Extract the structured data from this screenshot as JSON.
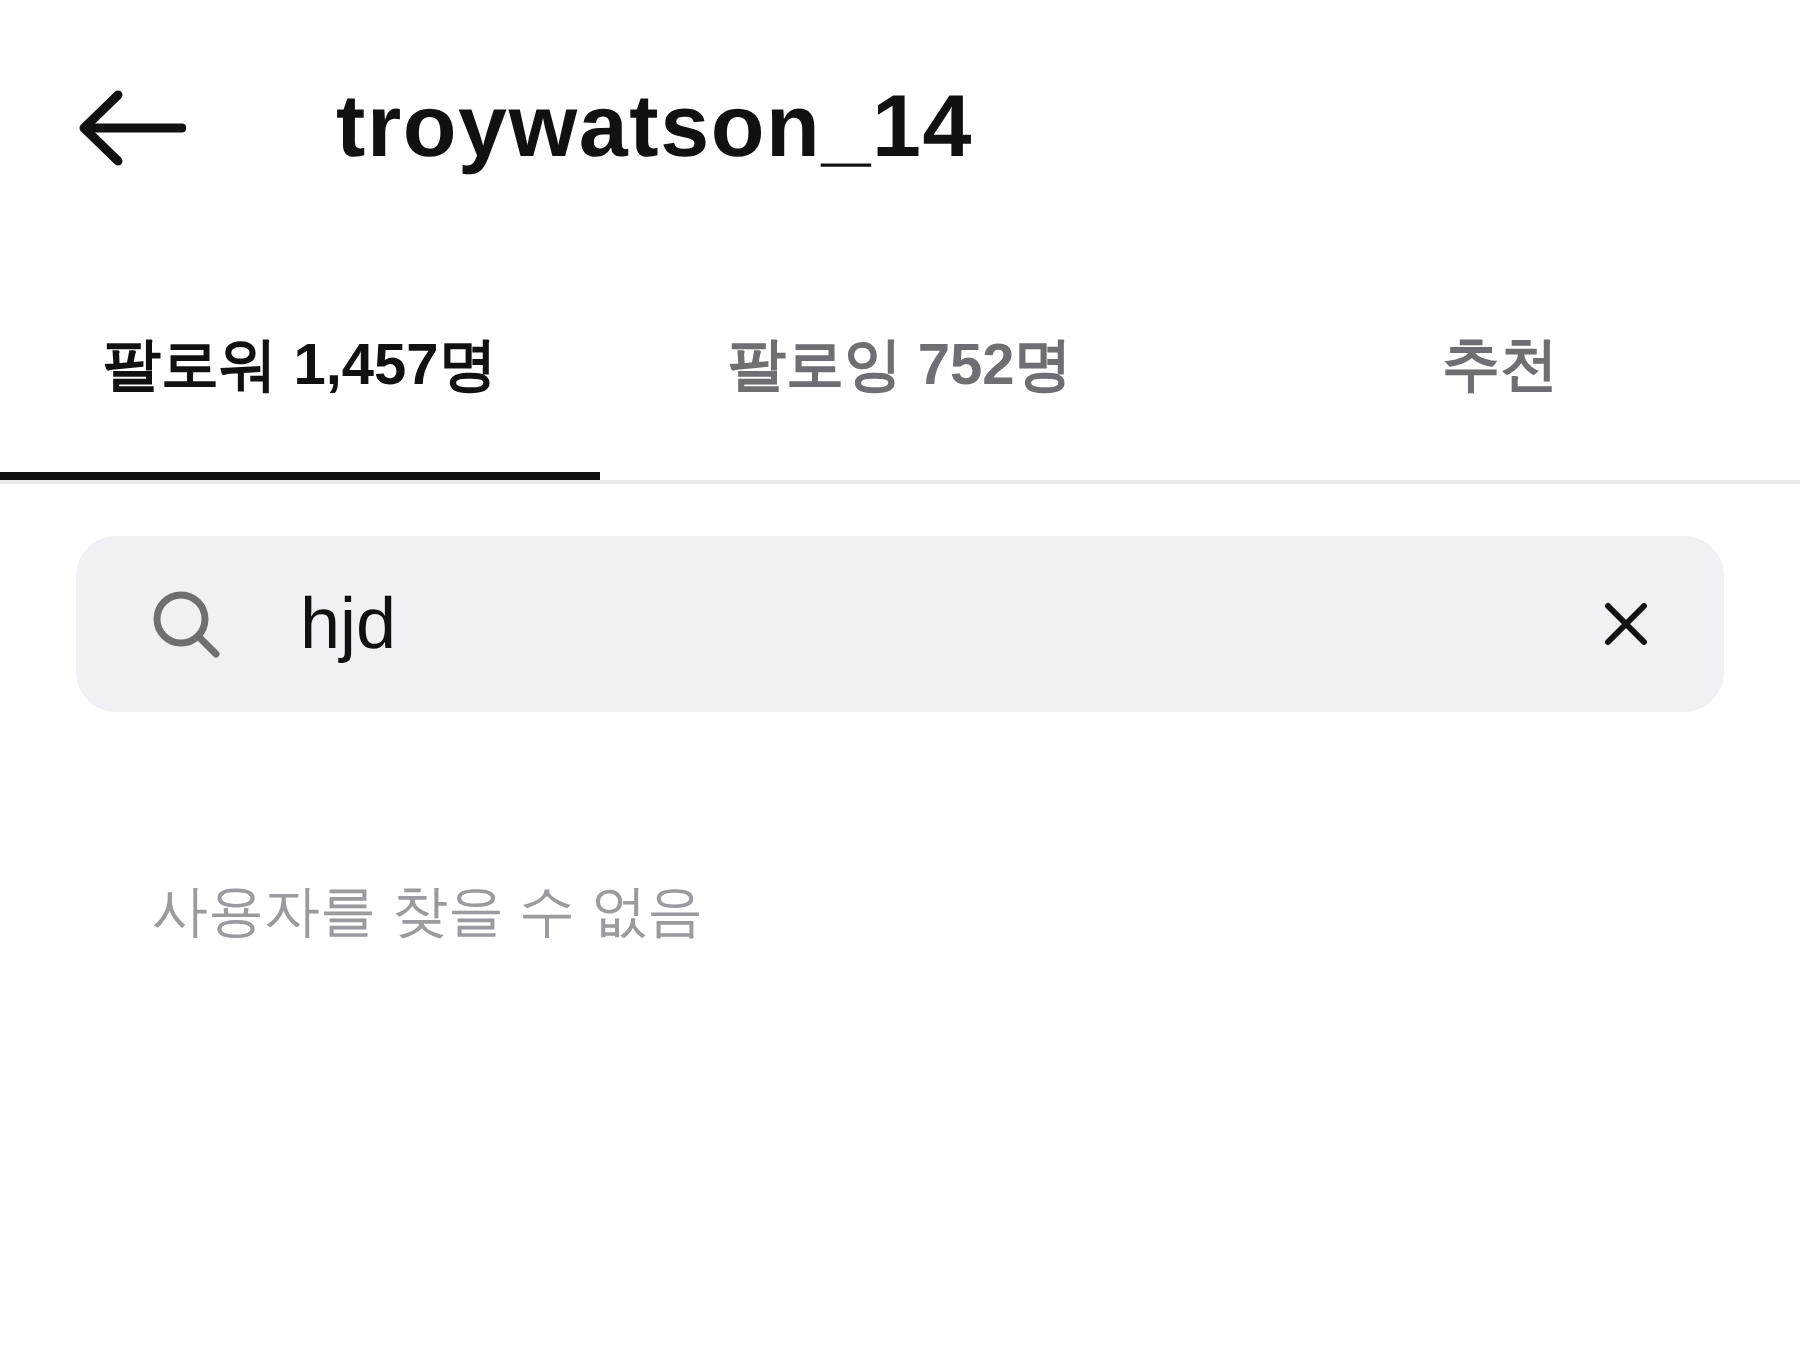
{
  "header": {
    "title": "troywatson_14"
  },
  "tabs": [
    {
      "label": "팔로워 1,457명",
      "selected": true
    },
    {
      "label": "팔로잉 752명",
      "selected": false
    },
    {
      "label": "추천",
      "selected": false
    }
  ],
  "search": {
    "value": "hjd"
  },
  "empty_message": "사용자를 찾을 수 없음"
}
